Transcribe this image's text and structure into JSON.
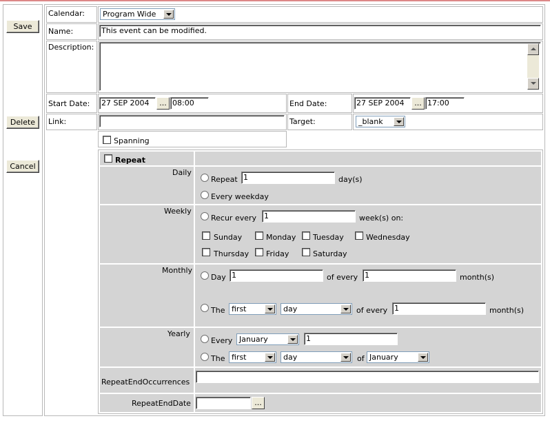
{
  "buttons": {
    "save": "Save",
    "delete": "Delete",
    "cancel": "Cancel"
  },
  "fields": {
    "calendar": {
      "label": "Calendar:",
      "value": "Program Wide"
    },
    "name": {
      "label": "Name:",
      "value": "This event can be modified."
    },
    "description": {
      "label": "Description:",
      "value": ""
    },
    "start_date": {
      "label": "Start Date:",
      "date": "27 SEP 2004",
      "time": "08:00"
    },
    "end_date": {
      "label": "End Date:",
      "date": "27 SEP 2004",
      "time": "17:00"
    },
    "link": {
      "label": "Link:",
      "value": ""
    },
    "target": {
      "label": "Target:",
      "value": "_blank"
    },
    "spanning": {
      "label": "Spanning"
    },
    "picker_label": "..."
  },
  "repeat": {
    "header": "Repeat",
    "daily": {
      "label": "Daily",
      "repeat": "Repeat",
      "repeat_value": "1",
      "unit": "day(s)",
      "every_weekday": "Every weekday"
    },
    "weekly": {
      "label": "Weekly",
      "recur_every": "Recur every",
      "value": "1",
      "unit": "week(s) on:",
      "days": [
        "Sunday",
        "Monday",
        "Tuesday",
        "Wednesday",
        "Thursday",
        "Friday",
        "Saturday"
      ]
    },
    "monthly": {
      "label": "Monthly",
      "day": "Day",
      "day_value": "1",
      "of_every": "of every",
      "every_value": "1",
      "unit": "month(s)",
      "the": "The",
      "ordinal": "first",
      "day_type": "day",
      "of_every2": "of every",
      "every_value2": "1",
      "unit2": "month(s)"
    },
    "yearly": {
      "label": "Yearly",
      "every": "Every",
      "month": "January",
      "day_value": "1",
      "the": "The",
      "ordinal": "first",
      "day_type": "day",
      "of": "of",
      "month2": "January"
    },
    "end_occurrences": {
      "label": "RepeatEndOccurrences",
      "value": ""
    },
    "end_date": {
      "label": "RepeatEndDate",
      "value": ""
    }
  }
}
